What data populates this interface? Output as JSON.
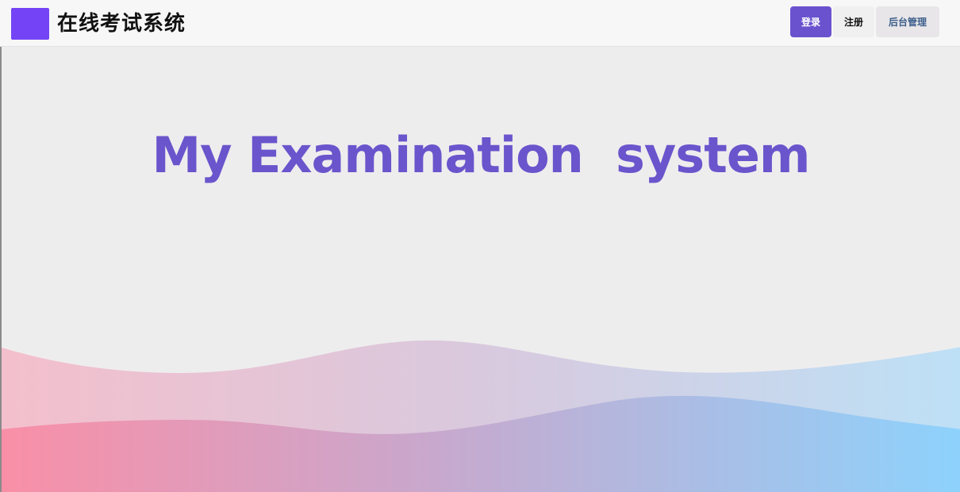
{
  "header": {
    "logo_color": "#7443f5",
    "title": "在线考试系统",
    "buttons": {
      "login": "登录",
      "register": "注册",
      "admin": "后台管理"
    }
  },
  "hero": {
    "title": "My Examination  system",
    "title_color": "#6a55cc",
    "wave_colors": [
      "#f58ea8",
      "#c7a9cc",
      "#8fd3fd"
    ]
  }
}
